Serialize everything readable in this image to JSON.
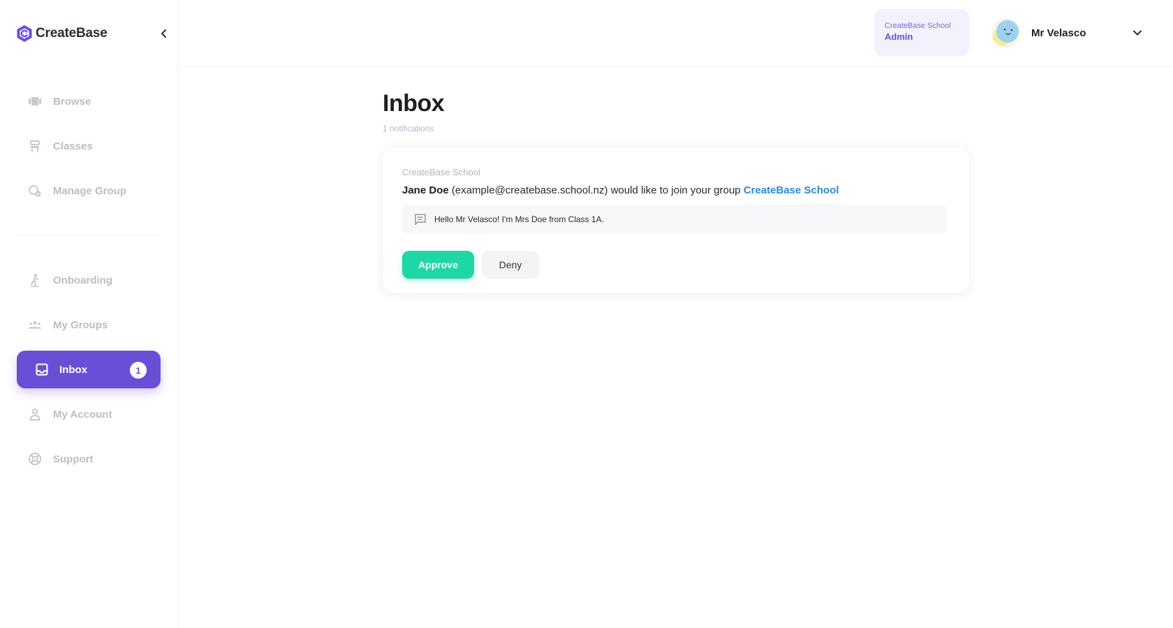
{
  "brand": {
    "name": "CreateBase"
  },
  "sidebar": {
    "items": [
      {
        "label": "Browse",
        "icon": "browse-icon"
      },
      {
        "label": "Classes",
        "icon": "classes-icon"
      },
      {
        "label": "Manage Group",
        "icon": "manage-group-icon"
      },
      {
        "label": "Onboarding",
        "icon": "onboarding-icon"
      },
      {
        "label": "My Groups",
        "icon": "my-groups-icon"
      },
      {
        "label": "Inbox",
        "icon": "inbox-icon",
        "active": true,
        "badge": "1"
      },
      {
        "label": "My Account",
        "icon": "my-account-icon"
      },
      {
        "label": "Support",
        "icon": "support-icon"
      }
    ]
  },
  "header": {
    "school": "CreateBase School",
    "role": "Admin",
    "user_name": "Mr Velasco"
  },
  "main": {
    "title": "Inbox",
    "subtitle": "1 notifications",
    "notification": {
      "group_label": "CreateBase School",
      "requester_name": "Jane Doe",
      "requester_email_part": " (example@createbase.school.nz) would like to join your group ",
      "group_link": "CreateBase School",
      "message": "Hello Mr Velasco! I'm Mrs Doe from Class 1A.",
      "approve_label": "Approve",
      "deny_label": "Deny"
    }
  },
  "colors": {
    "accent": "#6a4fd6",
    "approve": "#1ed7a5",
    "link": "#2a8ad6",
    "muted_nav": "#bdbdc6"
  }
}
